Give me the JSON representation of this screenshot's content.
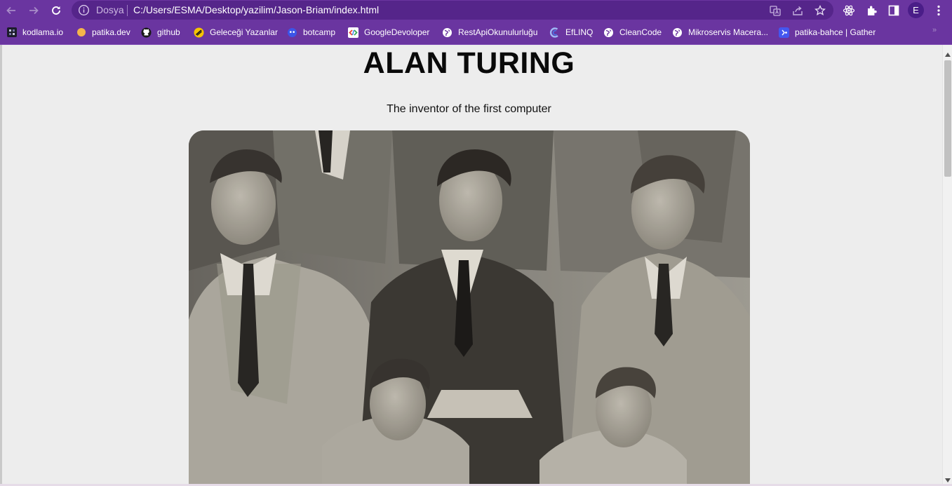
{
  "browser": {
    "address_bar": {
      "scheme_label": "Dosya",
      "url": "C:/Users/ESMA/Desktop/yazilim/Jason-Briam/index.html"
    },
    "profile_initial": "E"
  },
  "bookmarks": [
    {
      "label": "kodlama.io",
      "icon": "kodlama-icon"
    },
    {
      "label": "patika.dev",
      "icon": "patika-icon"
    },
    {
      "label": "github",
      "icon": "github-icon"
    },
    {
      "label": "Geleceği Yazanlar",
      "icon": "gelecegi-yazanlar-icon"
    },
    {
      "label": "botcamp",
      "icon": "botcamp-icon"
    },
    {
      "label": "GoogleDevoloper",
      "icon": "google-developer-icon"
    },
    {
      "label": "RestApiOkunulurluğu",
      "icon": "globe-icon"
    },
    {
      "label": "EfLINQ",
      "icon": "eflinq-icon"
    },
    {
      "label": "CleanCode",
      "icon": "globe-icon"
    },
    {
      "label": "Mikroservis Macera...",
      "icon": "globe-icon"
    },
    {
      "label": "patika-bahce | Gather",
      "icon": "gather-icon"
    }
  ],
  "page": {
    "title": "ALAN TURING",
    "subtitle": "The inventor of the first computer"
  },
  "colors": {
    "browser_chrome": "#6a35a0",
    "page_background": "#ededed"
  }
}
